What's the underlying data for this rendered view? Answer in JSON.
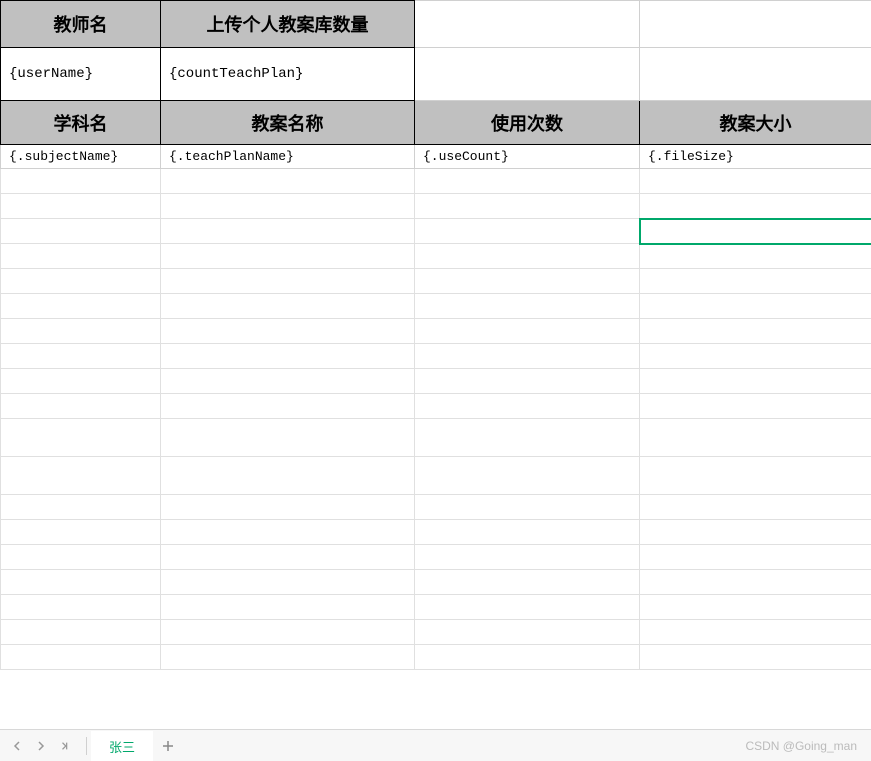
{
  "headers": {
    "teacher_name": "教师名",
    "upload_count": "上传个人教案库数量",
    "subject_name": "学科名",
    "plan_name": "教案名称",
    "use_count": "使用次数",
    "file_size": "教案大小"
  },
  "template_row1": {
    "user_name": "{userName}",
    "count_teach_plan": "{countTeachPlan}"
  },
  "template_row2": {
    "subject_name": "{.subjectName}",
    "teach_plan_name": "{.teachPlanName}",
    "use_count": "{.useCount}",
    "file_size": "{.fileSize}"
  },
  "sheet": {
    "active_tab": "张三"
  },
  "watermark": "CSDN @Going_man"
}
